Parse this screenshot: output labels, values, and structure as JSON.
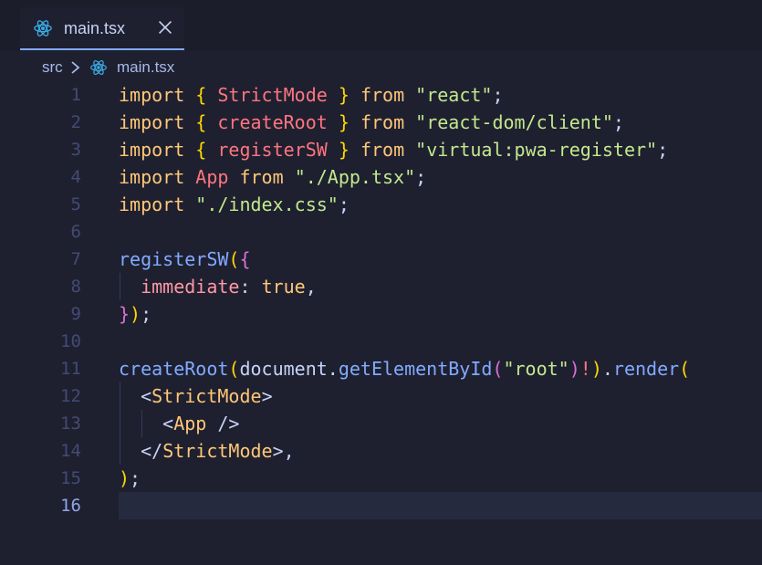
{
  "tab": {
    "filename": "main.tsx",
    "icon": "react-icon",
    "close_icon": "close-icon"
  },
  "breadcrumb": {
    "folder": "src",
    "file": "main.tsx"
  },
  "editor": {
    "current_line": 16,
    "lines": [
      {
        "n": "1",
        "tokens": [
          [
            "kw",
            "import"
          ],
          [
            "plain",
            " "
          ],
          [
            "brace1",
            "{"
          ],
          [
            "plain",
            " "
          ],
          [
            "name",
            "StrictMode"
          ],
          [
            "plain",
            " "
          ],
          [
            "brace1",
            "}"
          ],
          [
            "plain",
            " "
          ],
          [
            "kw",
            "from"
          ],
          [
            "plain",
            " "
          ],
          [
            "str",
            "\"react\""
          ],
          [
            "plain",
            ";"
          ]
        ]
      },
      {
        "n": "2",
        "tokens": [
          [
            "kw",
            "import"
          ],
          [
            "plain",
            " "
          ],
          [
            "brace1",
            "{"
          ],
          [
            "plain",
            " "
          ],
          [
            "name",
            "createRoot"
          ],
          [
            "plain",
            " "
          ],
          [
            "brace1",
            "}"
          ],
          [
            "plain",
            " "
          ],
          [
            "kw",
            "from"
          ],
          [
            "plain",
            " "
          ],
          [
            "str",
            "\"react-dom/client\""
          ],
          [
            "plain",
            ";"
          ]
        ]
      },
      {
        "n": "3",
        "tokens": [
          [
            "kw",
            "import"
          ],
          [
            "plain",
            " "
          ],
          [
            "brace1",
            "{"
          ],
          [
            "plain",
            " "
          ],
          [
            "name",
            "registerSW"
          ],
          [
            "plain",
            " "
          ],
          [
            "brace1",
            "}"
          ],
          [
            "plain",
            " "
          ],
          [
            "kw",
            "from"
          ],
          [
            "plain",
            " "
          ],
          [
            "str",
            "\"virtual:pwa-register\""
          ],
          [
            "plain",
            ";"
          ]
        ]
      },
      {
        "n": "4",
        "tokens": [
          [
            "kw",
            "import"
          ],
          [
            "plain",
            " "
          ],
          [
            "name",
            "App"
          ],
          [
            "plain",
            " "
          ],
          [
            "kw",
            "from"
          ],
          [
            "plain",
            " "
          ],
          [
            "str",
            "\"./App.tsx\""
          ],
          [
            "plain",
            ";"
          ]
        ]
      },
      {
        "n": "5",
        "tokens": [
          [
            "kw",
            "import"
          ],
          [
            "plain",
            " "
          ],
          [
            "str",
            "\"./index.css\""
          ],
          [
            "plain",
            ";"
          ]
        ]
      },
      {
        "n": "6",
        "tokens": []
      },
      {
        "n": "7",
        "tokens": [
          [
            "fn",
            "registerSW"
          ],
          [
            "brace1",
            "("
          ],
          [
            "brace2",
            "{"
          ]
        ]
      },
      {
        "n": "8",
        "tokens": [
          [
            "plain",
            "  "
          ],
          [
            "prop",
            "immediate"
          ],
          [
            "plain",
            ": "
          ],
          [
            "val",
            "true"
          ],
          [
            "plain",
            ","
          ]
        ]
      },
      {
        "n": "9",
        "tokens": [
          [
            "brace2",
            "}"
          ],
          [
            "brace1",
            ")"
          ],
          [
            "plain",
            ";"
          ]
        ]
      },
      {
        "n": "10",
        "tokens": []
      },
      {
        "n": "11",
        "tokens": [
          [
            "fn",
            "createRoot"
          ],
          [
            "brace1",
            "("
          ],
          [
            "plain",
            "document."
          ],
          [
            "fn",
            "getElementById"
          ],
          [
            "brace2",
            "("
          ],
          [
            "str",
            "\"root\""
          ],
          [
            "brace2",
            ")"
          ],
          [
            "name",
            "!"
          ],
          [
            "brace1",
            ")"
          ],
          [
            "plain",
            "."
          ],
          [
            "fn",
            "render"
          ],
          [
            "brace1",
            "("
          ]
        ]
      },
      {
        "n": "12",
        "tokens": [
          [
            "plain",
            "  "
          ],
          [
            "tag",
            "<"
          ],
          [
            "tagname",
            "StrictMode"
          ],
          [
            "tag",
            ">"
          ]
        ]
      },
      {
        "n": "13",
        "tokens": [
          [
            "plain",
            "    "
          ],
          [
            "tag",
            "<"
          ],
          [
            "tagname",
            "App"
          ],
          [
            "tag",
            " />"
          ]
        ]
      },
      {
        "n": "14",
        "tokens": [
          [
            "plain",
            "  "
          ],
          [
            "tag",
            "</"
          ],
          [
            "tagname",
            "StrictMode"
          ],
          [
            "tag",
            ">"
          ],
          [
            "plain",
            ","
          ]
        ]
      },
      {
        "n": "15",
        "tokens": [
          [
            "brace1",
            ")"
          ],
          [
            "plain",
            ";"
          ]
        ]
      },
      {
        "n": "16",
        "tokens": []
      }
    ]
  }
}
